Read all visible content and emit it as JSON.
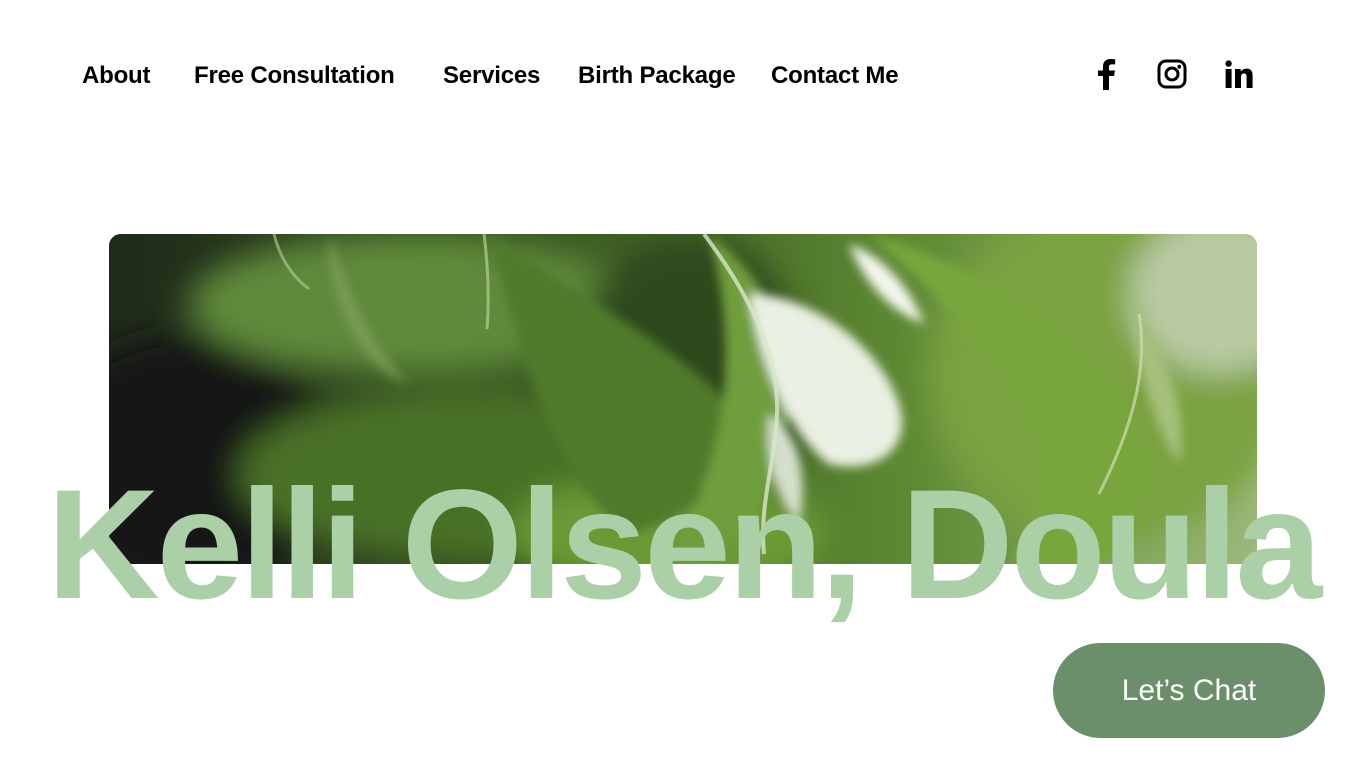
{
  "nav": {
    "items": [
      {
        "label": "About"
      },
      {
        "label": "Free Consultation"
      },
      {
        "label": "Services"
      },
      {
        "label": "Birth Package"
      },
      {
        "label": "Contact Me"
      }
    ],
    "social": [
      {
        "icon": "facebook-icon"
      },
      {
        "icon": "instagram-icon"
      },
      {
        "icon": "linkedin-icon"
      }
    ]
  },
  "hero": {
    "title": "Kelli Olsen, Doula"
  },
  "chat": {
    "label": "Let’s Chat"
  },
  "colors": {
    "title": "#abcfa6",
    "chat_button": "#6a8f6a",
    "nav_text": "#000000"
  }
}
